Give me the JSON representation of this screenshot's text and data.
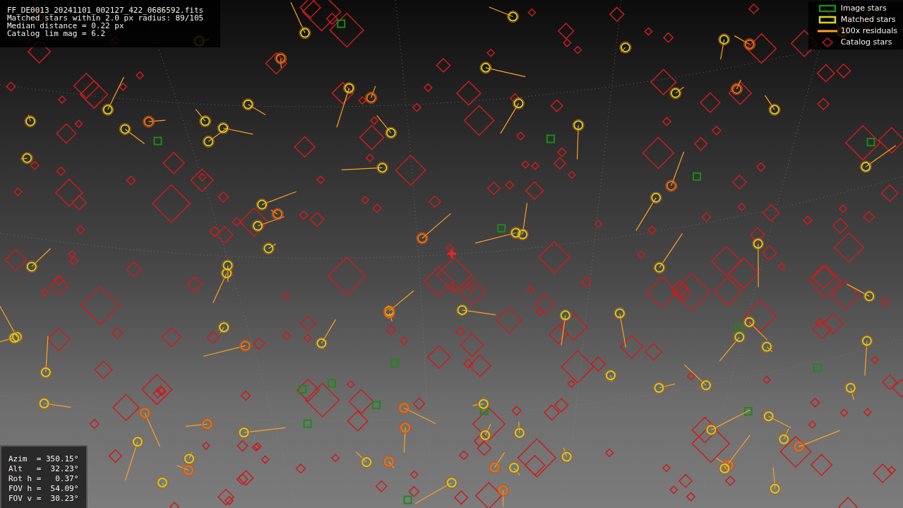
{
  "info_lines": [
    "FF_DE0013_20241101_002127_422_0686592.fits",
    "Matched stars within 2.0 px radius: 89/105",
    "Median distance = 0.22 px",
    "Catalog lim mag = 6.2"
  ],
  "legend": [
    {
      "kind": "image",
      "label": "Image stars",
      "color": "#1a8a1a"
    },
    {
      "kind": "matched",
      "label": "Matched stars",
      "color": "#d8d820"
    },
    {
      "kind": "residual",
      "label": "100x residuals",
      "color": "#ffa020"
    },
    {
      "kind": "catalog",
      "label": "Catalog stars",
      "color": "#c81e1e"
    }
  ],
  "pointing": [
    "Azim  = 350.15°",
    "Alt   =  32.23°",
    "Rot h =   0.37°",
    "FOV h =  54.09°",
    "FOV v =  30.23°"
  ]
}
